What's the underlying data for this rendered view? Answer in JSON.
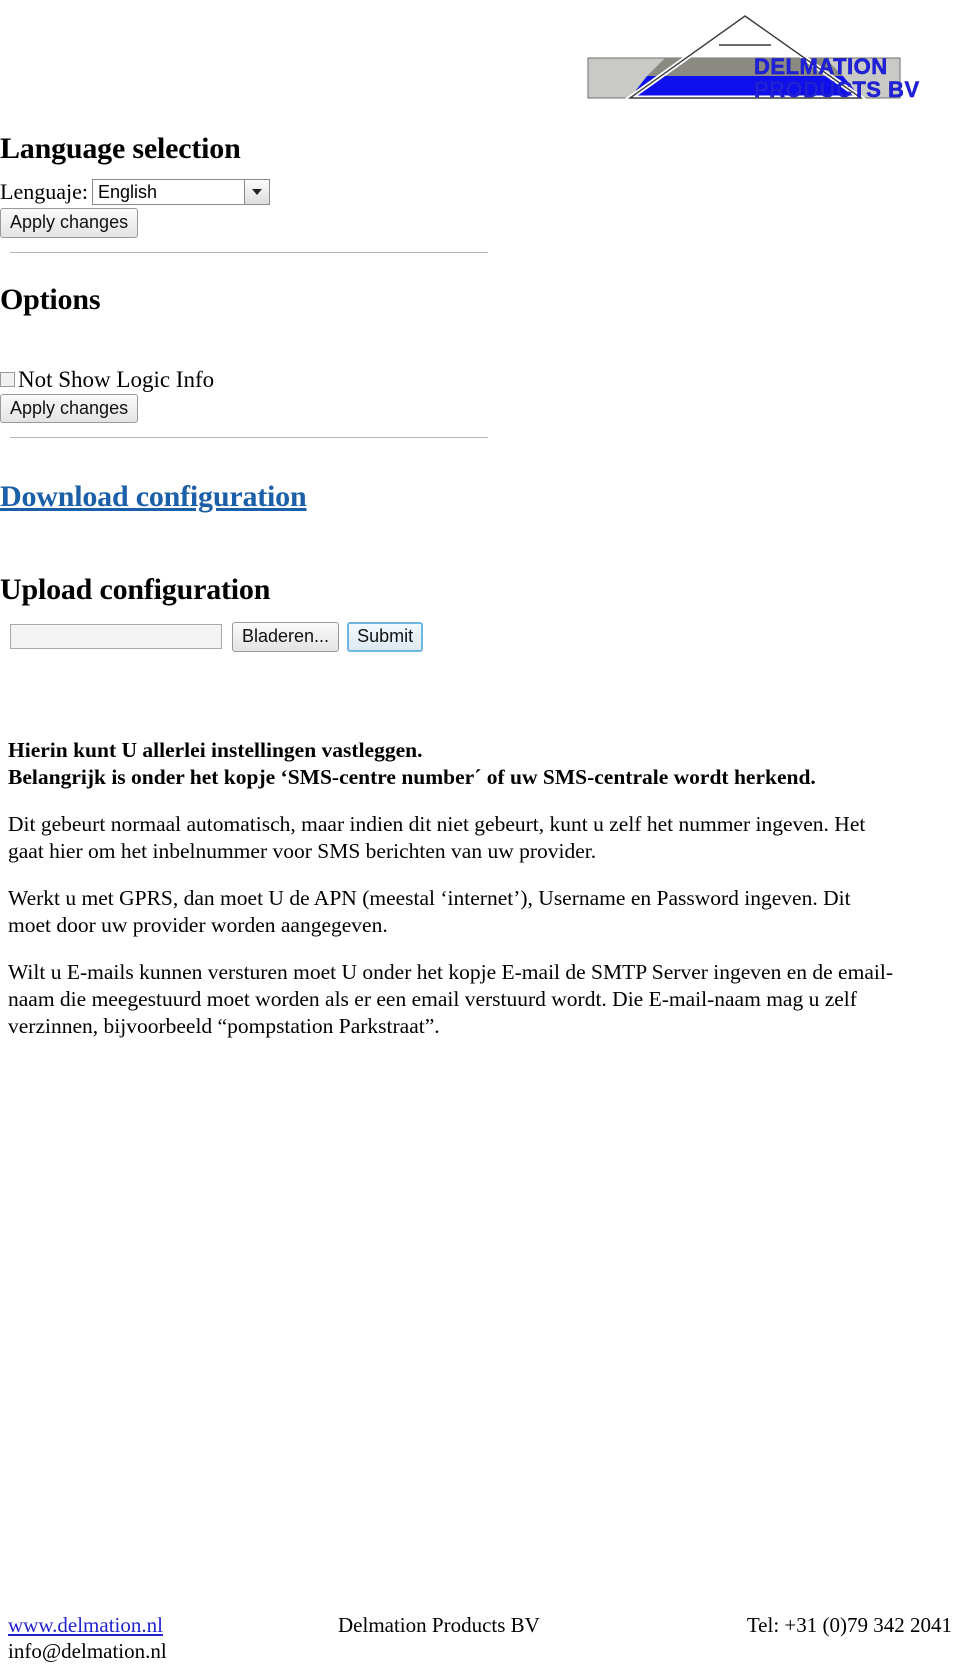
{
  "logo": {
    "company_line1": "DELMATION",
    "company_line2": "PRODUCTS BV",
    "brand_blue": "#2222dd",
    "band_light_gray": "#c9c9c6",
    "band_mid_gray": "#8a8a83",
    "band_blue": "#1010ee"
  },
  "webui": {
    "language_section": {
      "heading": "Language selection",
      "label": "Lenguaje:",
      "selected_value": "English",
      "apply_label": "Apply changes"
    },
    "options_section": {
      "heading": "Options",
      "checkbox_label": "Not Show Logic Info",
      "checkbox_checked": false,
      "apply_label": "Apply changes"
    },
    "download_section": {
      "heading": "Download configuration"
    },
    "upload_section": {
      "heading": "Upload configuration",
      "file_value": "",
      "browse_label": "Bladeren...",
      "submit_label": "Submit"
    }
  },
  "prose": {
    "p1_line1": "Hierin kunt U allerlei instellingen vastleggen.",
    "p1_line2": "Belangrijk is onder het kopje ‘SMS-centre number´ of uw SMS-centrale wordt herkend.",
    "p2": "Dit gebeurt normaal automatisch, maar indien dit niet gebeurt, kunt u zelf het nummer ingeven. Het gaat hier om het inbelnummer voor SMS berichten van uw provider.",
    "p3": "Werkt u met GPRS, dan moet U de APN (meestal ‘internet’), Username en Password ingeven. Dit moet door uw provider worden aangegeven.",
    "p4": "Wilt u E-mails kunnen versturen moet U onder het kopje E-mail de SMTP Server ingeven en de email-naam die meegestuurd moet worden als er een email verstuurd wordt. Die E-mail-naam mag u zelf verzinnen, bijvoorbeeld “pompstation Parkstraat”."
  },
  "footer": {
    "website": "www.delmation.nl",
    "email": "info@delmation.nl",
    "company": "Delmation Products BV",
    "phone": "Tel: +31 (0)79 342 2041"
  }
}
